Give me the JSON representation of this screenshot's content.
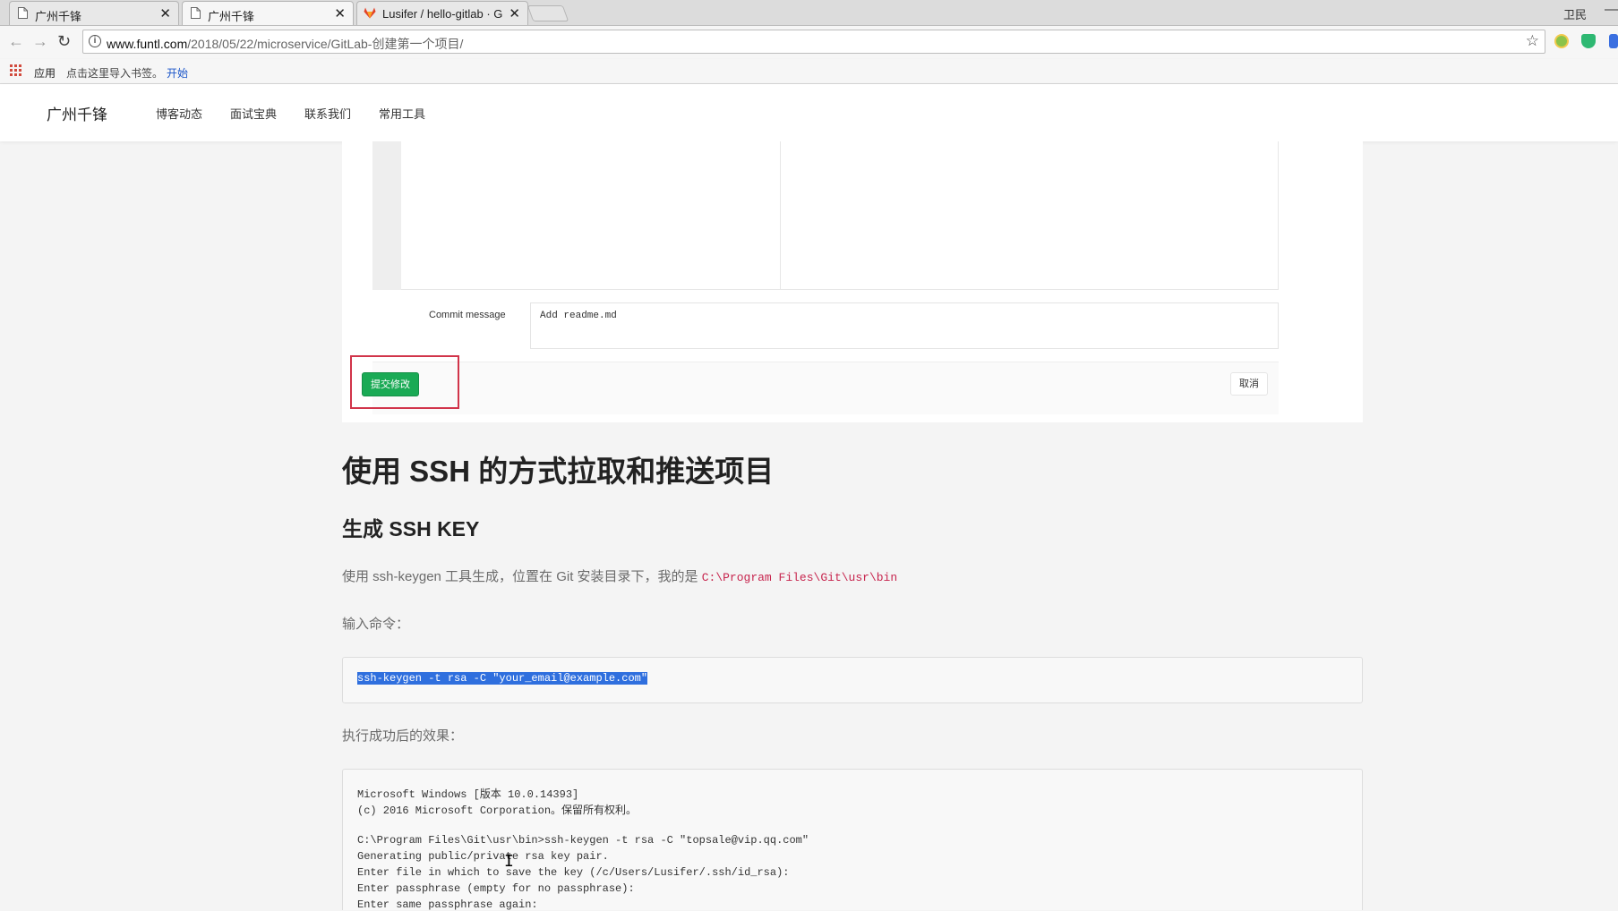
{
  "browser": {
    "tabs": [
      {
        "title": "广州千锋",
        "active": false
      },
      {
        "title": "广州千锋",
        "active": true
      },
      {
        "title": "Lusifer / hello-gitlab · G",
        "active": false
      }
    ],
    "user": "卫民",
    "url_domain": "www.funtl.com",
    "url_path": "/2018/05/22/microservice/GitLab-创建第一个项目/",
    "bookmarks": {
      "apps": "应用",
      "hint": "点击这里导入书签。",
      "start": "开始"
    }
  },
  "site": {
    "brand": "广州千锋",
    "menu": [
      "博客动态",
      "面试宝典",
      "联系我们",
      "常用工具"
    ]
  },
  "screenshot": {
    "commit_label": "Commit message",
    "commit_value": "Add readme.md",
    "submit_label": "提交修改",
    "cancel_label": "取消"
  },
  "article": {
    "h1": "使用 SSH 的方式拉取和推送项目",
    "h2": "生成 SSH KEY",
    "p1_text": "使用 ssh-keygen 工具生成，位置在 Git 安装目录下，我的是 ",
    "p1_code": "C:\\Program Files\\Git\\usr\\bin",
    "p2": "输入命令：",
    "command": "ssh-keygen -t rsa -C \"your_email@example.com\"",
    "p3": "执行成功后的效果：",
    "terminal_lines": [
      "Microsoft Windows [版本 10.0.14393]",
      "(c) 2016 Microsoft Corporation。保留所有权利。",
      "",
      "C:\\Program Files\\Git\\usr\\bin>ssh-keygen -t rsa -C \"topsale@vip.qq.com\"",
      "Generating public/private rsa key pair.",
      "Enter file in which to save the key (/c/Users/Lusifer/.ssh/id_rsa):",
      "Enter passphrase (empty for no passphrase):",
      "Enter same passphrase again:"
    ]
  },
  "colors": {
    "accent_green": "#1aaa55",
    "highlight_red": "#d1344a",
    "code_red": "#c7254e",
    "selection_blue": "#2f6fde"
  }
}
